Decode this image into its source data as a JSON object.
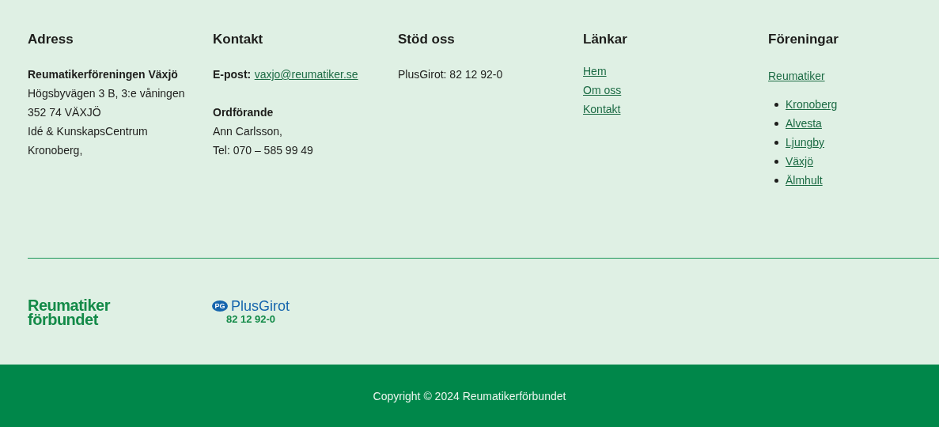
{
  "columns": [
    {
      "heading": "Adress",
      "kind": "address",
      "name": "Reumatikerföreningen Växjö",
      "lines": [
        "Högsbyvägen 3 B, 3:e våningen",
        "352 74 VÄXJÖ",
        "Idé & KunskapsCentrum",
        "Kronoberg,"
      ]
    },
    {
      "heading": "Kontakt",
      "kind": "contact",
      "email_label": "E-post:",
      "email": "vaxjo@reumatiker.se",
      "role": "Ordförande",
      "lines": [
        "Ann Carlsson,",
        "Tel: 070 – 585 99 49"
      ]
    },
    {
      "heading": "Stöd oss",
      "kind": "text",
      "lines": [
        "PlusGirot: 82 12 92-0"
      ]
    },
    {
      "heading": "Länkar",
      "kind": "links",
      "links": [
        "Hem",
        "Om oss",
        "Kontakt"
      ]
    },
    {
      "heading": "Föreningar",
      "kind": "associations",
      "main_link": "Reumatiker",
      "links": [
        "Kronoberg",
        "Alvesta",
        "Ljungby",
        "Växjö",
        "Älmhult"
      ]
    }
  ],
  "logos": {
    "brand_line_1": "Reumatiker",
    "brand_line_2": "förbundet",
    "pg_badge": "PG",
    "pg_name": "PlusGirot",
    "pg_number": "82 12 92-0"
  },
  "copyright": "Copyright © 2024 Reumatikerförbundet"
}
